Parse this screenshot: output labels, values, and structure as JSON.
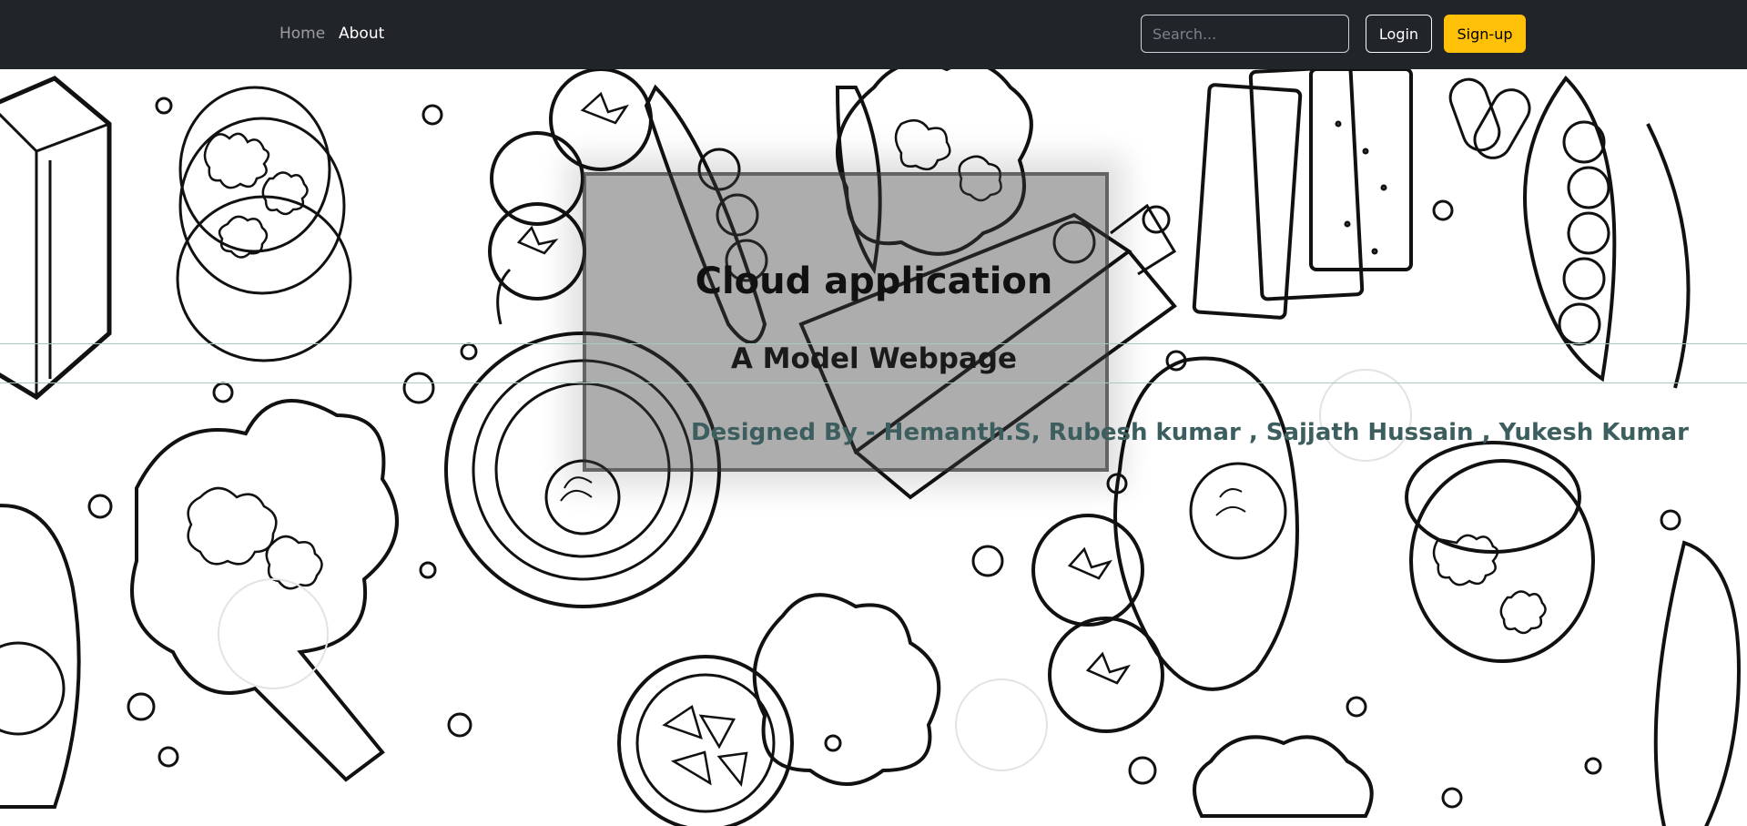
{
  "navbar": {
    "links": [
      {
        "label": "Home",
        "active": false
      },
      {
        "label": "About",
        "active": true
      }
    ],
    "search": {
      "placeholder": "Search...",
      "value": ""
    },
    "login_label": "Login",
    "signup_label": "Sign-up"
  },
  "hero": {
    "title": "Cloud application",
    "subtitle": "A Model Webpage",
    "credits": "Designed By - Hemanth.S, Rubesh kumar , Sajjath Hussain , Yukesh Kumar"
  },
  "colors": {
    "navbar_bg": "#212529",
    "signup_bg": "#ffc107",
    "credits_text": "#3d5e5f"
  }
}
